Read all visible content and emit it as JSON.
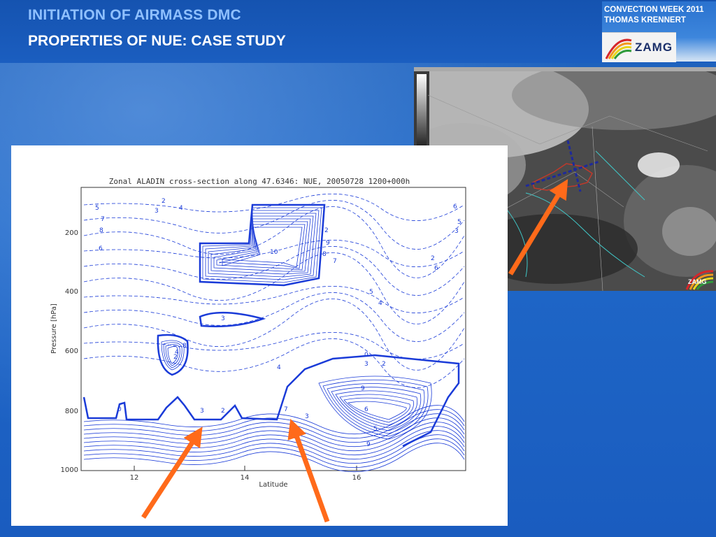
{
  "header": {
    "title_line1": "INITIATION OF AIRMASS DMC",
    "title_line2": "PROPERTIES OF NUE: CASE STUDY"
  },
  "badge": {
    "line1": "CONVECTION WEEK 2011",
    "line2": "THOMAS KRENNERT",
    "logo_text": "ZAMG"
  },
  "satellite": {
    "logo_text": "ZAMG"
  },
  "cross_section": {
    "title": "Zonal ALADIN cross-section along 47.6346: NUE,  20050728 1200+000h",
    "xlabel": "Latitude",
    "ylabel": "Pressure [hPa]",
    "x_ticks": [
      "12",
      "14",
      "16"
    ],
    "y_ticks": [
      "200",
      "400",
      "600",
      "800",
      "1000"
    ],
    "contour_labels": [
      "5",
      "7",
      "8",
      "6",
      "2",
      "4",
      "3",
      "10",
      "2",
      "9",
      "8",
      "7",
      "6",
      "5",
      "3",
      "2",
      "6",
      "5",
      "4",
      "3",
      "4",
      "2",
      "8",
      "7",
      "4",
      "0",
      "3",
      "2",
      "5",
      "9",
      "6",
      "3",
      "0",
      "2",
      "3",
      "9"
    ]
  },
  "colors": {
    "accent_title": "#8fc0ff",
    "contour": "#1a3bd8",
    "arrow": "#ff6a1a"
  }
}
